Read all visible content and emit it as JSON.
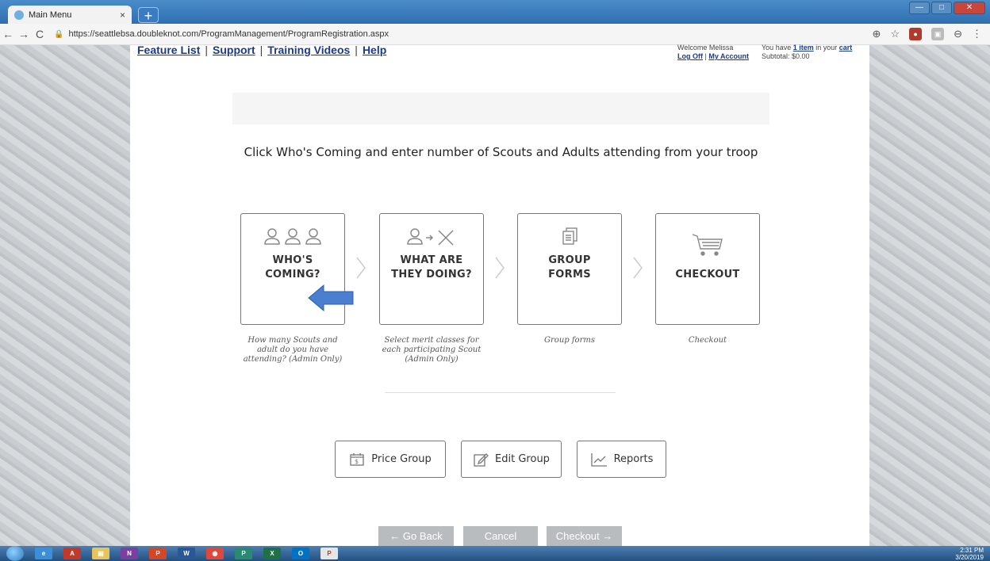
{
  "browser": {
    "tab_title": "Main Menu",
    "tab_close": "×",
    "new_tab": "+",
    "url": "https://seattlebsa.doubleknot.com/ProgramManagement/ProgramRegistration.aspx",
    "back": "←",
    "forward": "→",
    "reload": "C"
  },
  "header": {
    "links": [
      "Feature List",
      "Support",
      "Training Videos",
      "Help"
    ],
    "separator": "|",
    "welcome_text": "Welcome Melissa",
    "logoff": "Log Off",
    "account": "My Account",
    "cart_prefix": "You have",
    "cart_count": "1 item",
    "cart_mid": "in your",
    "cart_link": "cart",
    "subtotal": "Subtotal: $0.00"
  },
  "instruction": "Click Who's Coming and enter number of Scouts and Adults attending from your troop",
  "steps": [
    {
      "title_line1": "WHO'S",
      "title_line2": "COMING?",
      "description": "How many Scouts and adult do you have attending? (Admin Only)",
      "icon": "people-icon"
    },
    {
      "title_line1": "WHAT ARE",
      "title_line2": "THEY DOING?",
      "description": "Select merit classes for each participating Scout (Admin Only)",
      "icon": "activity-icon"
    },
    {
      "title_line1": "GROUP",
      "title_line2": "FORMS",
      "description": "Group forms",
      "icon": "forms-icon"
    },
    {
      "title_line1": "CHECKOUT",
      "title_line2": "",
      "description": "Checkout",
      "icon": "cart-icon"
    }
  ],
  "actions": {
    "price_group": "Price Group",
    "edit_group": "Edit Group",
    "reports": "Reports"
  },
  "nav": {
    "go_back": "← Go Back",
    "cancel": "Cancel",
    "checkout": "Checkout →"
  },
  "taskbar": {
    "time": "2:31 PM",
    "date": "3/20/2019",
    "apps": [
      "ie-icon",
      "acrobat-icon",
      "explorer-icon",
      "onenote-icon",
      "powerpoint-icon",
      "word-icon",
      "chrome-icon",
      "publisher-icon",
      "excel-icon",
      "outlook-icon",
      "pdf-icon"
    ]
  },
  "colors": {
    "link": "#1a3a8a",
    "arrow": "#4a7fcf",
    "nav_button": "#b9bcbf"
  }
}
